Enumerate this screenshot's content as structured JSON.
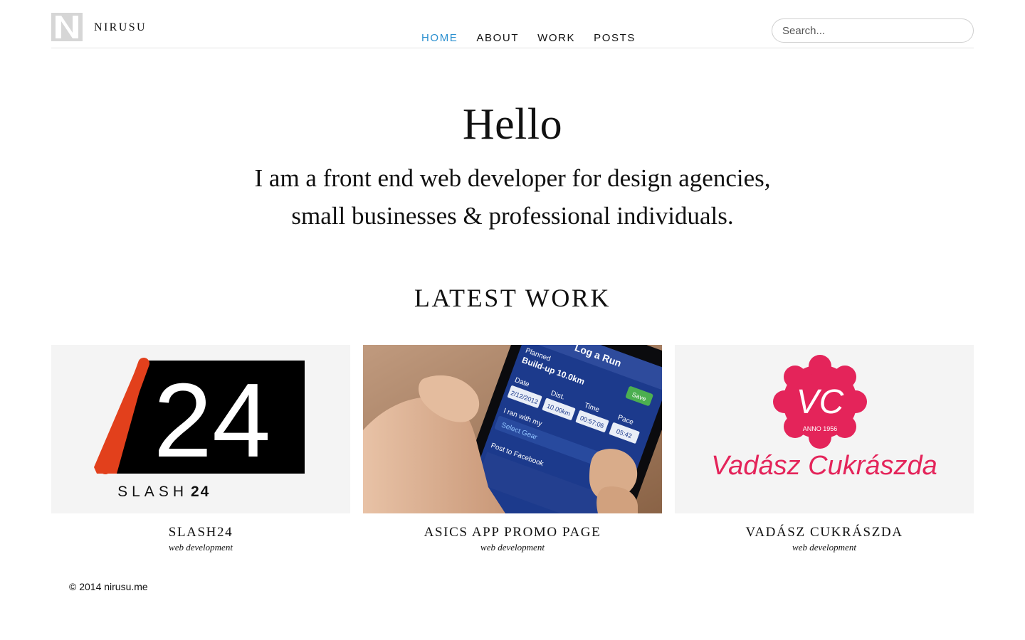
{
  "header": {
    "brand": "NIRUSU",
    "nav": [
      {
        "label": "HOME",
        "active": true
      },
      {
        "label": "ABOUT",
        "active": false
      },
      {
        "label": "WORK",
        "active": false
      },
      {
        "label": "POSTS",
        "active": false
      }
    ],
    "search_placeholder": "Search..."
  },
  "hero": {
    "title": "Hello",
    "tagline_line1": "I am a front end web developer for design agencies,",
    "tagline_line2": "small businesses & professional individuals."
  },
  "latest_work": {
    "heading": "LATEST WORK",
    "items": [
      {
        "title": "SLASH24",
        "category": "web development",
        "thumb_text_main": "24",
        "thumb_text_word": "SLASH",
        "thumb_text_num": "24"
      },
      {
        "title": "ASICS APP PROMO PAGE",
        "category": "web development",
        "thumb_screen_title": "Log a Run",
        "thumb_save": "Save",
        "thumb_planned": "Planned",
        "thumb_plan_name": "Build-up 10.0km",
        "thumb_date_label": "Date",
        "thumb_date": "2/12/2012",
        "thumb_dist_label": "Dist.",
        "thumb_dist": "10.00km",
        "thumb_time_label": "Time",
        "thumb_time": "00:57:06",
        "thumb_pace_label": "Pace",
        "thumb_pace": "05:42",
        "thumb_ran_with": "I ran with my",
        "thumb_select_gear": "Select Gear",
        "thumb_post_fb": "Post to Facebook"
      },
      {
        "title": "VADÁSZ CUKRÁSZDA",
        "category": "web development",
        "thumb_monogram": "VC",
        "thumb_anno": "ANNO 1956",
        "thumb_script": "Vadász Cukrászda"
      }
    ]
  },
  "footer": {
    "copyright": "© 2014 nirusu.me"
  },
  "colors": {
    "accent": "#2a8fcf",
    "slash_orange": "#e2401c",
    "vadasz_pink": "#e4245a",
    "asics_blue": "#1c3a8c"
  }
}
